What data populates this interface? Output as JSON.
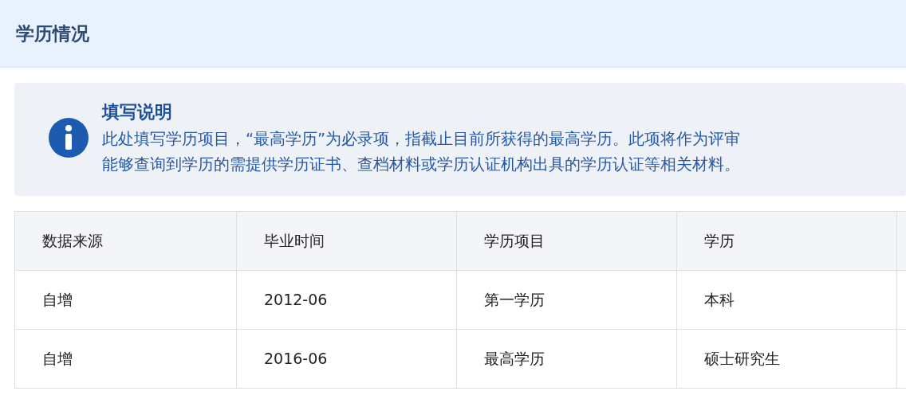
{
  "section": {
    "title": "学历情况"
  },
  "notice": {
    "title": "填写说明",
    "lines": [
      "此处填写学历项目，“最高学历”为必录项，指截止目前所获得的最高学历。此项将作为评审",
      "能够查询到学历的需提供学历证书、查档材料或学历认证机构出具的学历认证等相关材料。"
    ]
  },
  "table": {
    "columns": [
      "数据来源",
      "毕业时间",
      "学历项目",
      "学历"
    ],
    "rows": [
      [
        "自增",
        "2012-06",
        "第一学历",
        "本科"
      ],
      [
        "自增",
        "2016-06",
        "最高学历",
        "硕士研究生"
      ]
    ]
  }
}
